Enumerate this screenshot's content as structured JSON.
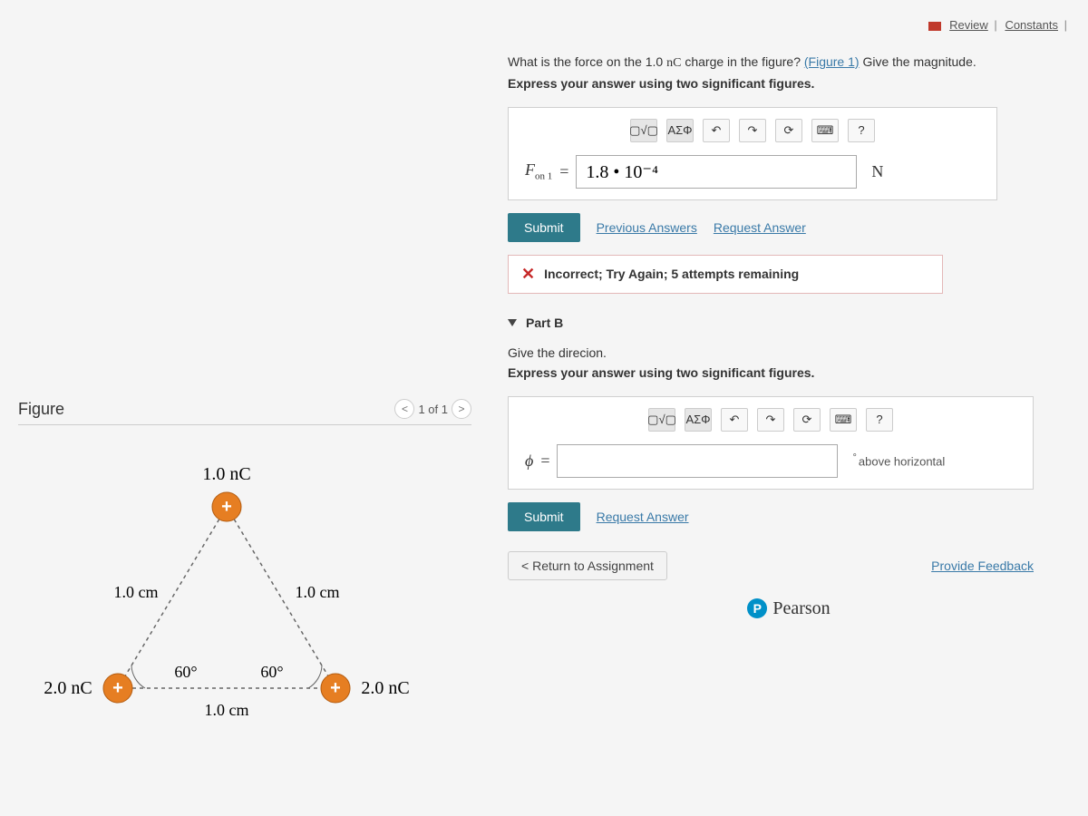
{
  "top_links": {
    "review": "Review",
    "constants": "Constants"
  },
  "partA": {
    "question_pre": "What is the force on the 1.0 ",
    "question_unit": "nC",
    "question_post": " charge in the figure?",
    "figure_link": "(Figure 1)",
    "question_tail": " Give the magnitude.",
    "instruction": "Express your answer using two significant figures.",
    "var_label": "F",
    "var_sub": "on 1",
    "equals": "=",
    "value": "1.8 • 10⁻⁴",
    "unit": "N",
    "toolbar": {
      "templates": "▢√▢",
      "greek": "ΑΣΦ",
      "undo": "↶",
      "redo": "↷",
      "reset": "⟳",
      "keyboard": "⌨",
      "help": "?"
    },
    "submit": "Submit",
    "prev_answers": "Previous Answers",
    "request_answer": "Request Answer",
    "feedback": "Incorrect; Try Again; 5 attempts remaining"
  },
  "partB": {
    "header": "Part B",
    "question": "Give the direcion.",
    "instruction": "Express your answer using two significant figures.",
    "var_label": "ϕ",
    "equals": "=",
    "value": "",
    "unit_prefix": "°",
    "unit": "above horizontal",
    "toolbar": {
      "templates": "▢√▢",
      "greek": "ΑΣΦ",
      "undo": "↶",
      "redo": "↷",
      "reset": "⟳",
      "keyboard": "⌨",
      "help": "?"
    },
    "submit": "Submit",
    "request_answer": "Request Answer"
  },
  "bottom": {
    "return": "Return to Assignment",
    "feedback": "Provide Feedback",
    "brand": "Pearson"
  },
  "figure": {
    "title": "Figure",
    "pager": "1 of 1",
    "top_charge": "1.0 nC",
    "left_charge": "2.0 nC",
    "right_charge": "2.0 nC",
    "side_left": "1.0 cm",
    "side_right": "1.0 cm",
    "side_bottom": "1.0 cm",
    "angle_left": "60°",
    "angle_right": "60°"
  }
}
